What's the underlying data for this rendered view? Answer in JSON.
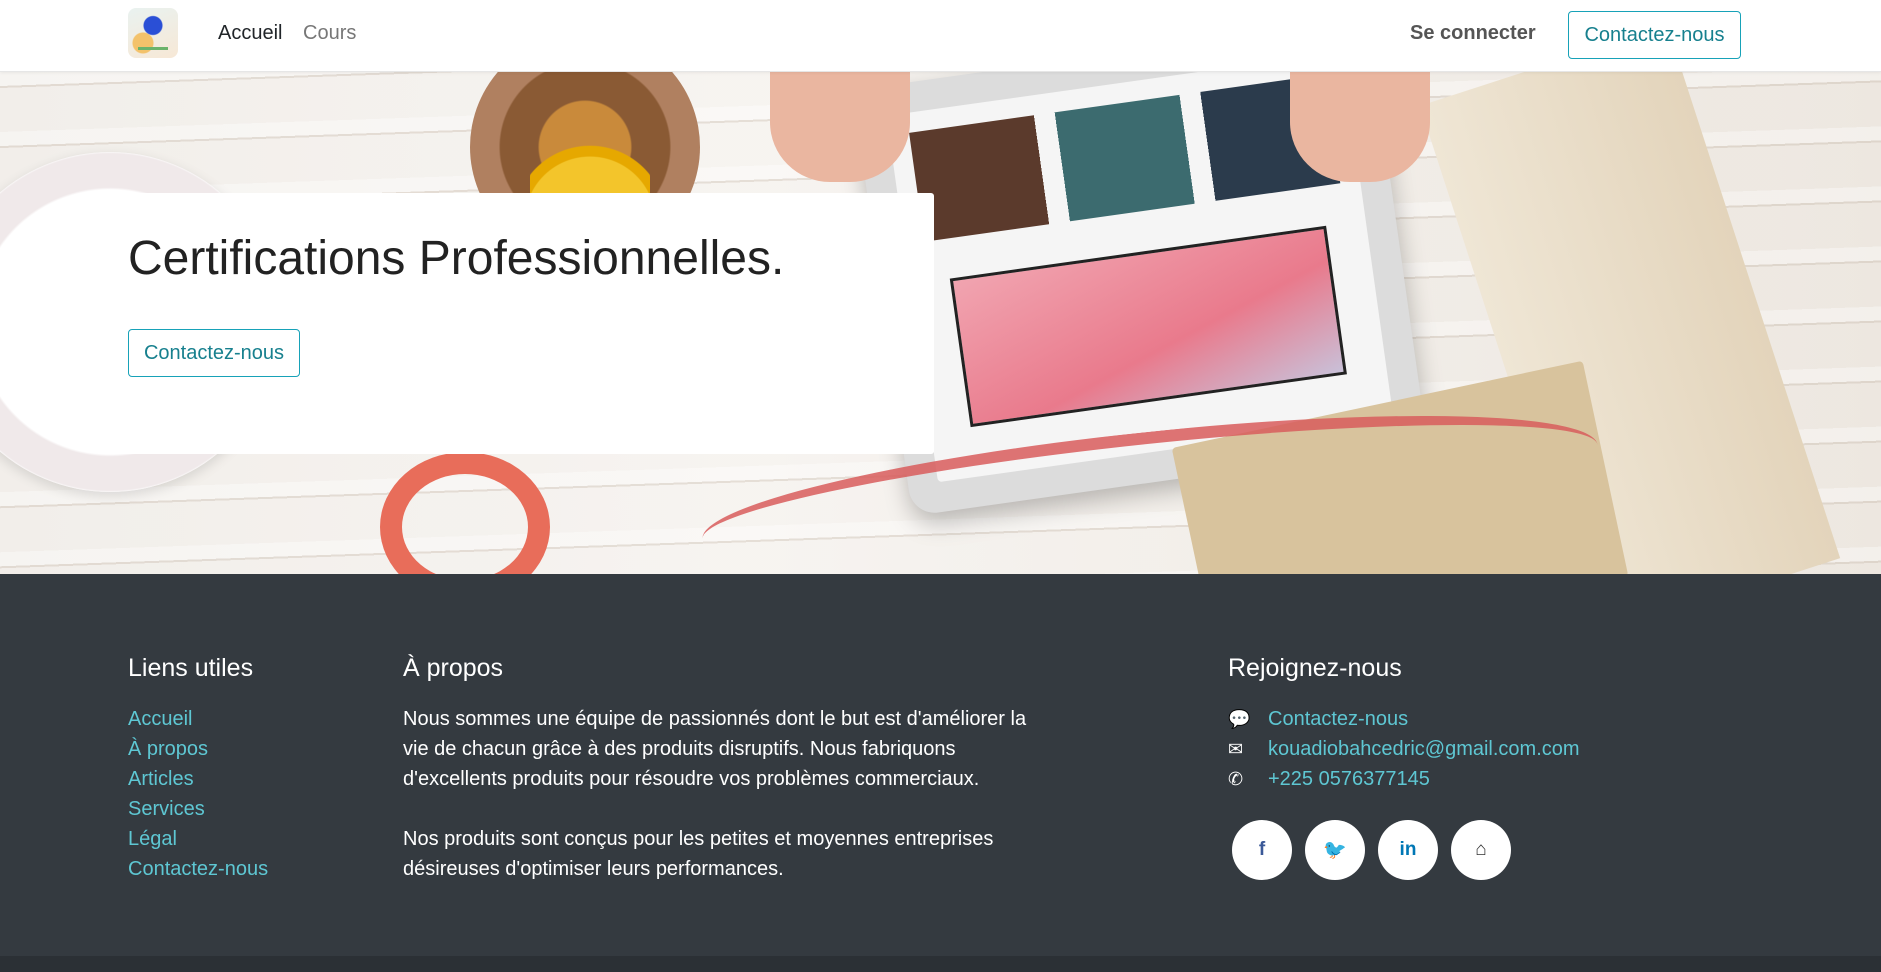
{
  "navbar": {
    "links": [
      "Accueil",
      "Cours"
    ],
    "login_label": "Se connecter",
    "contact_label": "Contactez-nous"
  },
  "hero": {
    "title": "Certifications Professionnelles.",
    "button_label": "Contactez-nous"
  },
  "footer": {
    "useful_links": {
      "heading": "Liens utiles",
      "items": [
        "Accueil",
        "À propos",
        "Articles",
        "Services",
        "Légal",
        "Contactez-nous"
      ]
    },
    "about": {
      "heading": "À propos",
      "paragraphs": [
        "Nous sommes une équipe de passionnés dont le but est d'améliorer la vie de chacun grâce à des produits disruptifs. Nous fabriquons d'excellents produits pour résoudre vos problèmes commerciaux.",
        "Nos produits sont conçus pour les petites et moyennes entreprises désireuses d'optimiser leurs performances."
      ]
    },
    "join": {
      "heading": "Rejoignez-nous",
      "contact_label": "Contactez-nous",
      "email": "kouadiobahcedric@gmail.com.com",
      "phone": "+225 0576377145"
    },
    "social": [
      {
        "icon": "facebook-icon",
        "glyph": "f"
      },
      {
        "icon": "twitter-icon",
        "glyph": "🐦"
      },
      {
        "icon": "linkedin-icon",
        "glyph": "in"
      },
      {
        "icon": "home-icon",
        "glyph": "⌂"
      }
    ]
  },
  "colors": {
    "accent": "#17a2b8",
    "link": "#5ec7d3",
    "footer_bg": "#343a40"
  }
}
